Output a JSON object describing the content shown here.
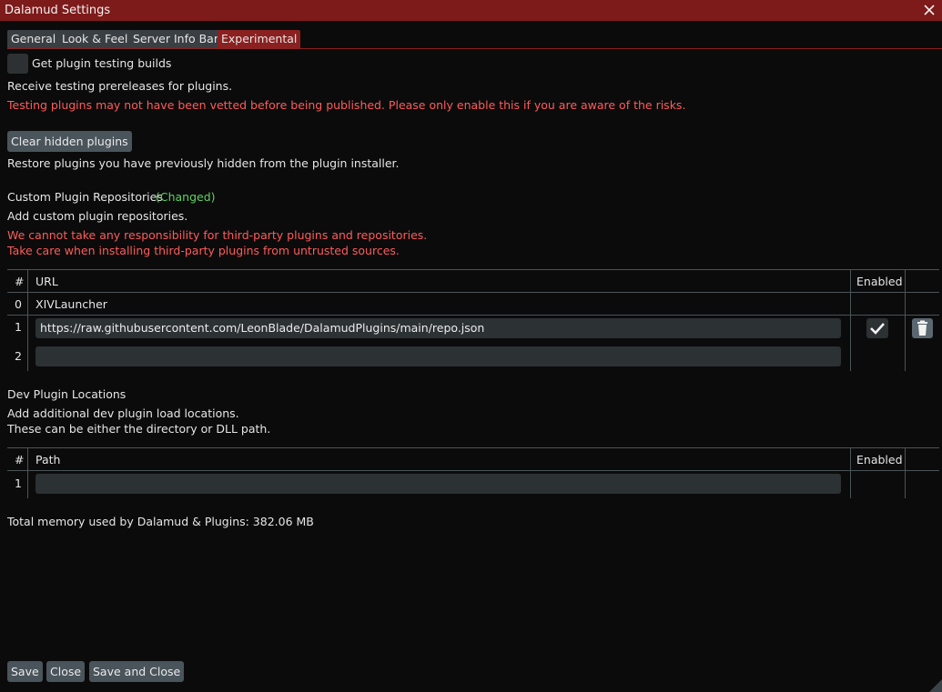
{
  "window": {
    "title": "Dalamud Settings"
  },
  "tabs": [
    {
      "label": "General"
    },
    {
      "label": "Look & Feel"
    },
    {
      "label": "Server Info Bar"
    },
    {
      "label": "Experimental"
    }
  ],
  "testing": {
    "checkbox_label": "Get plugin testing builds",
    "description": "Receive testing prereleases for plugins.",
    "warning": "Testing plugins may not have been vetted before being published. Please only enable this if you are aware of the risks."
  },
  "hidden": {
    "button_label": "Clear hidden plugins",
    "description": "Restore plugins you have previously hidden from the plugin installer."
  },
  "repos": {
    "heading": "Custom Plugin Repositories",
    "changed": "(Changed)",
    "description": "Add custom plugin repositories.",
    "warning1": "We cannot take any responsibility for third-party plugins and repositories.",
    "warning2": "Take care when installing third-party plugins from untrusted sources.",
    "columns": {
      "num": "#",
      "url": "URL",
      "enabled": "Enabled"
    },
    "rows": [
      {
        "num": "0",
        "url": "XIVLauncher"
      },
      {
        "num": "1",
        "url": "https://raw.githubusercontent.com/LeonBlade/DalamudPlugins/main/repo.json",
        "enabled": true
      },
      {
        "num": "2",
        "url": ""
      }
    ]
  },
  "dev": {
    "heading": "Dev Plugin Locations",
    "description1": "Add additional dev plugin load locations.",
    "description2": "These can be either the directory or DLL path.",
    "columns": {
      "num": "#",
      "path": "Path",
      "enabled": "Enabled"
    },
    "rows": [
      {
        "num": "1",
        "path": ""
      }
    ]
  },
  "memory": "Total memory used by Dalamud & Plugins: 382.06 MB",
  "footer": {
    "save": "Save",
    "close": "Close",
    "save_close": "Save and Close"
  },
  "colors": {
    "titlebar": "#7d1a1a",
    "accent": "#8b2020",
    "warning": "#ff5b5b",
    "changed": "#5fd35f"
  },
  "icons": [
    "close-icon",
    "checkmark-icon",
    "trash-icon",
    "resize-grip-icon"
  ]
}
